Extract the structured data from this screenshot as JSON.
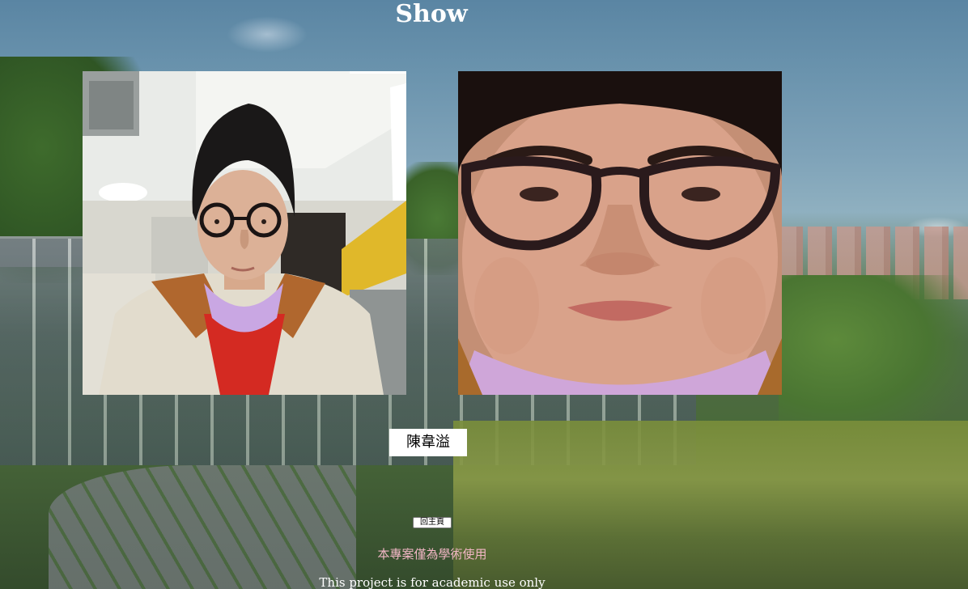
{
  "page": {
    "title": "Show"
  },
  "photos": {
    "left_alt": "",
    "right_alt": ""
  },
  "result": {
    "name": "陳韋溢"
  },
  "actions": {
    "home_label": "回主頁"
  },
  "footer": {
    "notice_cn": "本專案僅為學術使用",
    "notice_en": "This project is for academic use only"
  },
  "colors": {
    "title_text": "#ffffff",
    "notice_cn_text": "#f3b7c6",
    "notice_en_text": "#ffffff",
    "name_box_bg": "#ffffff"
  }
}
